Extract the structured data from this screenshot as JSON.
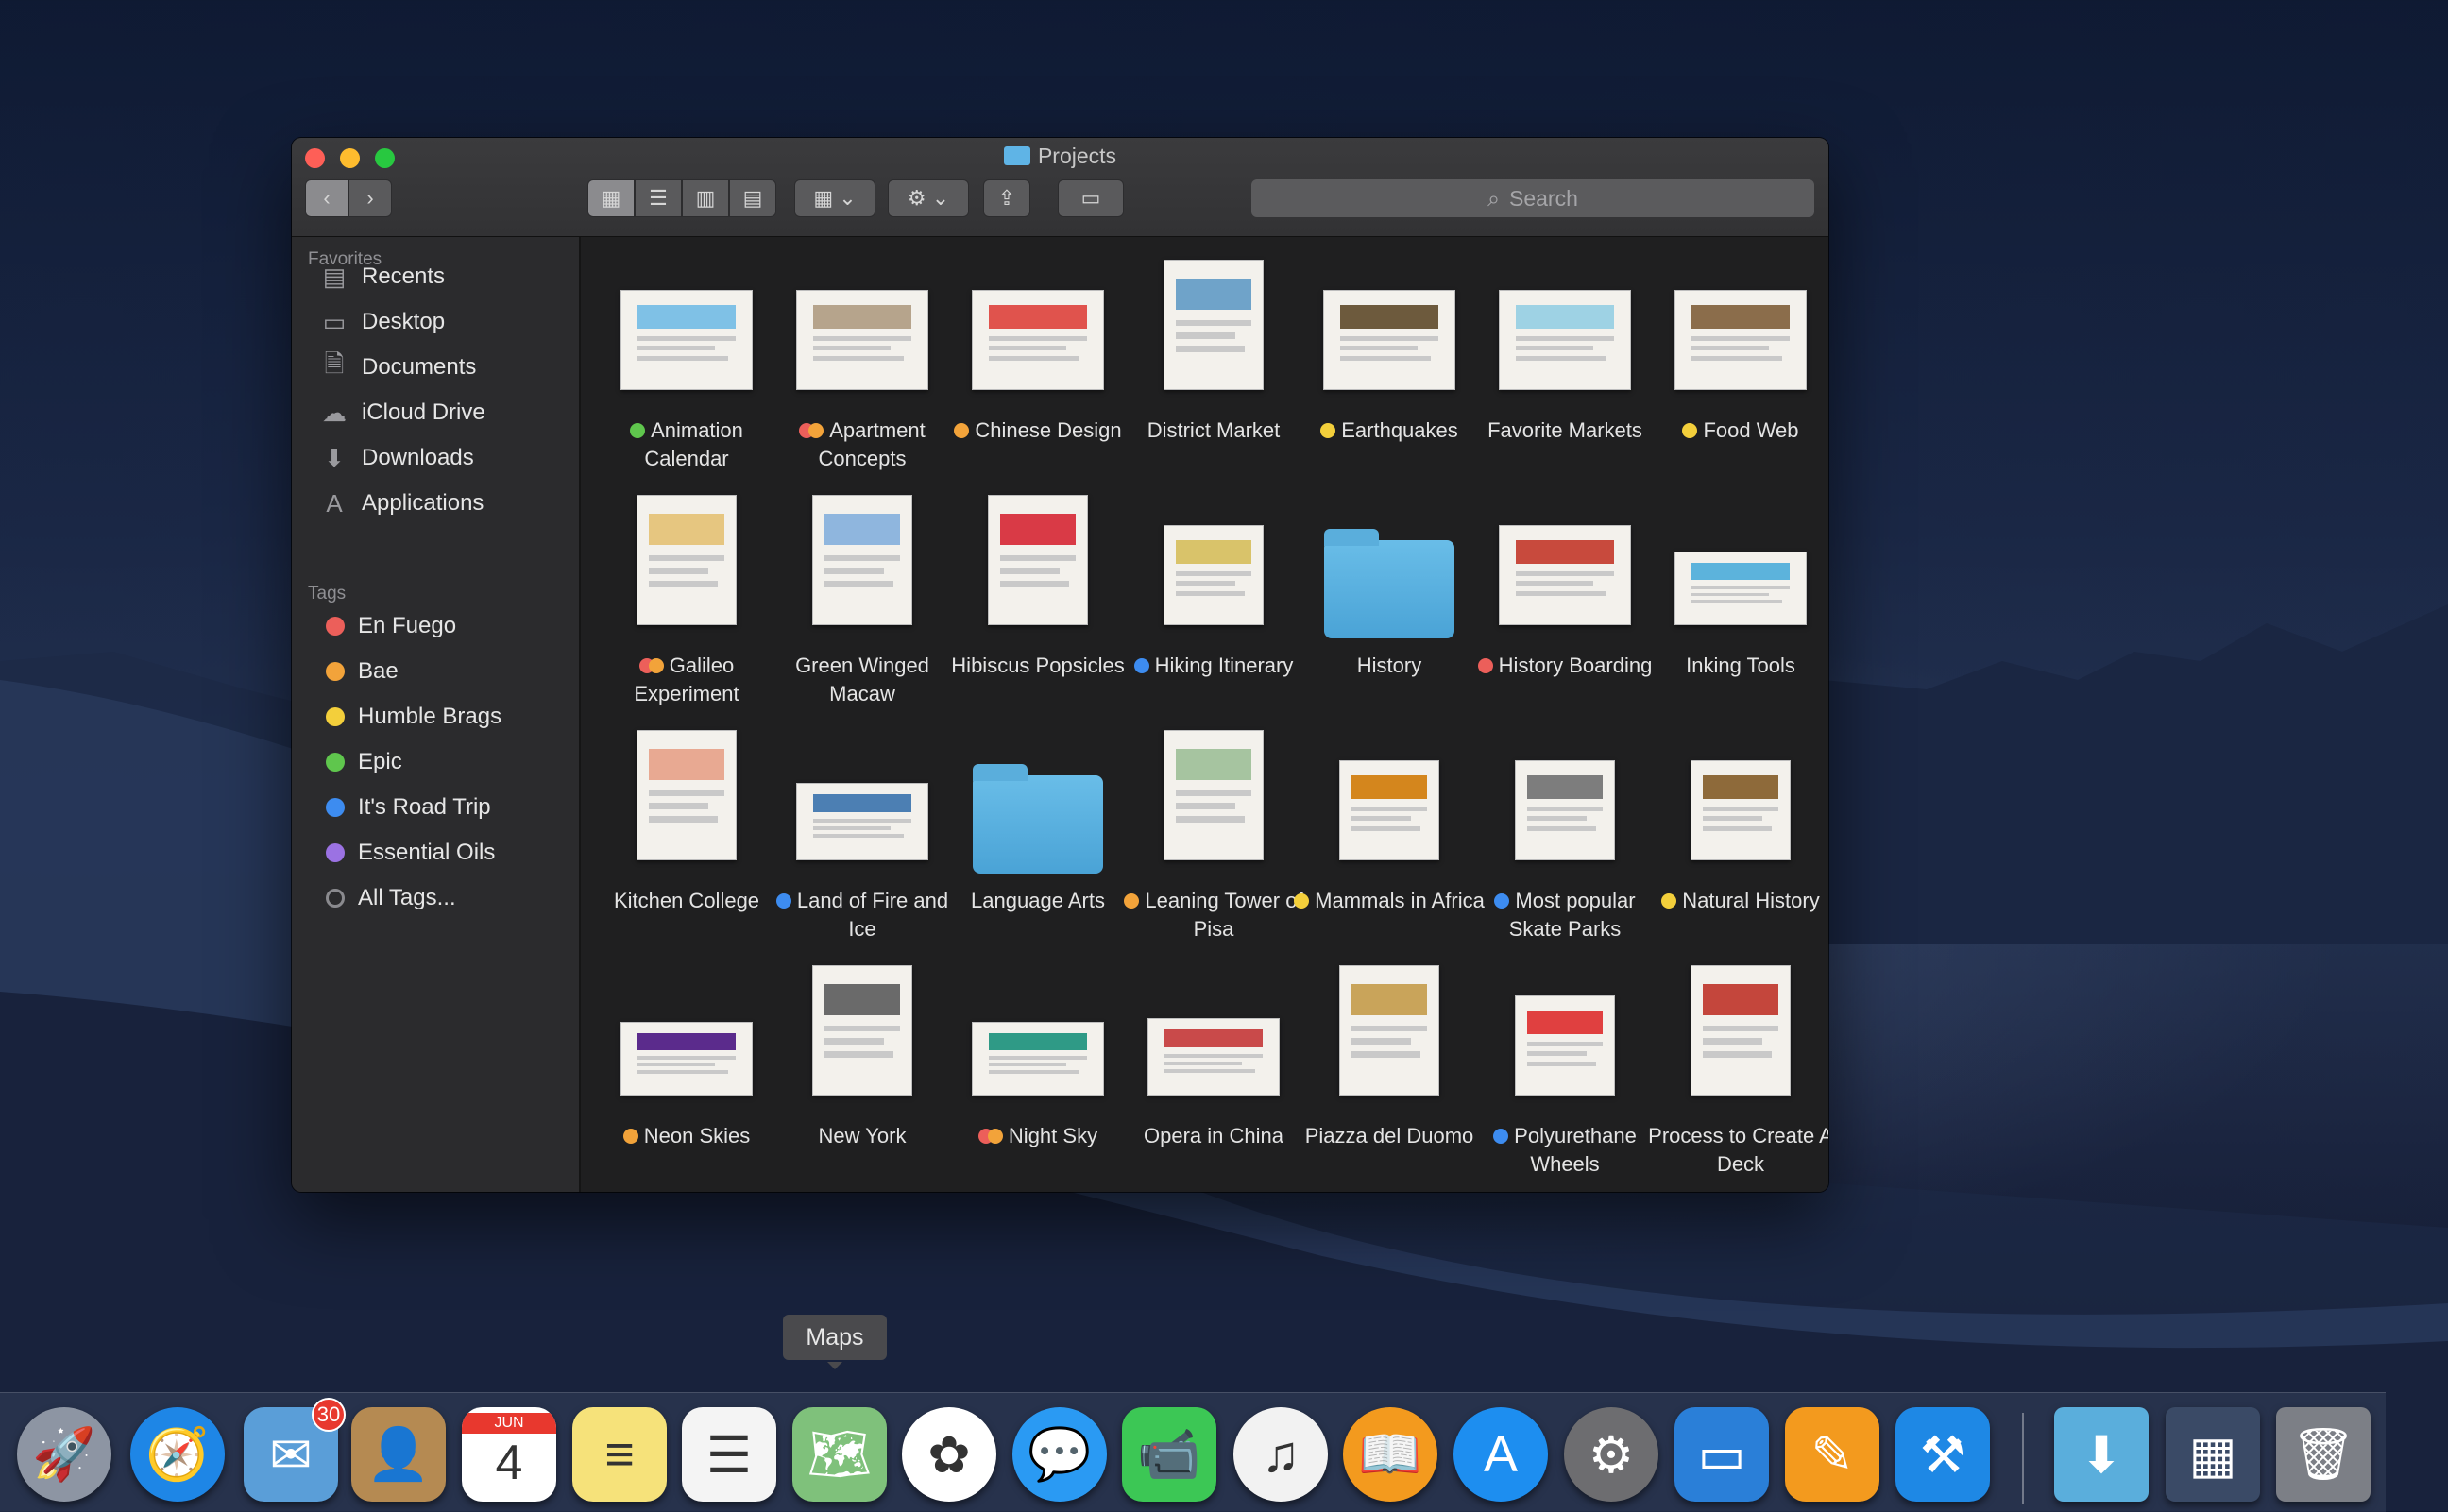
{
  "window": {
    "title": "Projects"
  },
  "toolbar": {
    "search_placeholder": "Search"
  },
  "sidebar": {
    "favorites_header": "Favorites",
    "favorites": [
      {
        "label": "Recents",
        "icon": "recents-icon"
      },
      {
        "label": "Desktop",
        "icon": "desktop-icon"
      },
      {
        "label": "Documents",
        "icon": "documents-icon"
      },
      {
        "label": "iCloud Drive",
        "icon": "icloud-icon"
      },
      {
        "label": "Downloads",
        "icon": "downloads-icon"
      },
      {
        "label": "Applications",
        "icon": "applications-icon"
      }
    ],
    "tags_header": "Tags",
    "tags": [
      {
        "label": "En Fuego",
        "color": "#ec5f5a"
      },
      {
        "label": "Bae",
        "color": "#f2a33a"
      },
      {
        "label": "Humble Brags",
        "color": "#f3cf3b"
      },
      {
        "label": "Epic",
        "color": "#5fc64d"
      },
      {
        "label": "It's Road Trip",
        "color": "#3d8cf0"
      },
      {
        "label": "Essential Oils",
        "color": "#9b72e3"
      },
      {
        "label": "All Tags...",
        "color": "#8a8a8e"
      }
    ]
  },
  "files": [
    {
      "name": "Animation Calendar",
      "tags": [
        "#5fc64d"
      ],
      "kind": "doc",
      "accent": "#7fc1e6"
    },
    {
      "name": "Apartment Concepts",
      "tags": [
        "#ec5f5a",
        "#f2a33a"
      ],
      "kind": "doc",
      "accent": "#b6a48c"
    },
    {
      "name": "Chinese Design",
      "tags": [
        "#f2a33a"
      ],
      "kind": "doc",
      "accent": "#e0534d"
    },
    {
      "name": "District Market",
      "tags": [],
      "kind": "doc",
      "accent": "#6fa3c9"
    },
    {
      "name": "Earthquakes",
      "tags": [
        "#f3cf3b"
      ],
      "kind": "doc",
      "accent": "#6d5a3d"
    },
    {
      "name": "Favorite Markets",
      "tags": [],
      "kind": "doc",
      "accent": "#9ed2e4"
    },
    {
      "name": "Food Web",
      "tags": [
        "#f3cf3b"
      ],
      "kind": "doc",
      "accent": "#8b6d4b"
    },
    {
      "name": "Galileo Experiment",
      "tags": [
        "#ec5f5a",
        "#f2a33a"
      ],
      "kind": "doc",
      "accent": "#e6c680"
    },
    {
      "name": "Green Winged Macaw",
      "tags": [],
      "kind": "doc",
      "accent": "#8fb6de"
    },
    {
      "name": "Hibiscus Popsicles",
      "tags": [],
      "kind": "doc",
      "accent": "#d93a46"
    },
    {
      "name": "Hiking Itinerary",
      "tags": [
        "#3d8cf0"
      ],
      "kind": "doc",
      "accent": "#d9c36a"
    },
    {
      "name": "History",
      "tags": [],
      "kind": "folder",
      "accent": "#5aaedc"
    },
    {
      "name": "History Boarding",
      "tags": [
        "#ec5f5a"
      ],
      "kind": "doc",
      "accent": "#c84a3d"
    },
    {
      "name": "Inking Tools",
      "tags": [],
      "kind": "doc",
      "accent": "#5cb3dc"
    },
    {
      "name": "Kitchen College",
      "tags": [],
      "kind": "doc",
      "accent": "#e8a992"
    },
    {
      "name": "Land of Fire and Ice",
      "tags": [
        "#3d8cf0"
      ],
      "kind": "doc",
      "accent": "#4c7fb3"
    },
    {
      "name": "Language Arts",
      "tags": [],
      "kind": "folder",
      "accent": "#5aaedc"
    },
    {
      "name": "Leaning Tower of Pisa",
      "tags": [
        "#f2a33a"
      ],
      "kind": "doc",
      "accent": "#a6c4a0"
    },
    {
      "name": "Mammals in Africa",
      "tags": [
        "#f3cf3b"
      ],
      "kind": "doc",
      "accent": "#d4861d"
    },
    {
      "name": "Most popular Skate Parks",
      "tags": [
        "#3d8cf0"
      ],
      "kind": "doc",
      "accent": "#7d7d7d"
    },
    {
      "name": "Natural History",
      "tags": [
        "#f3cf3b"
      ],
      "kind": "doc",
      "accent": "#8e6a3a"
    },
    {
      "name": "Neon Skies",
      "tags": [
        "#f2a33a"
      ],
      "kind": "doc",
      "accent": "#5b2b8c"
    },
    {
      "name": "New York",
      "tags": [],
      "kind": "doc",
      "accent": "#6a6a6a"
    },
    {
      "name": "Night Sky",
      "tags": [
        "#ec5f5a",
        "#f2a33a"
      ],
      "kind": "doc",
      "accent": "#2f9a86"
    },
    {
      "name": "Opera in China",
      "tags": [],
      "kind": "doc",
      "accent": "#c94a4a"
    },
    {
      "name": "Piazza del Duomo",
      "tags": [],
      "kind": "doc",
      "accent": "#c9a45a"
    },
    {
      "name": "Polyurethane Wheels",
      "tags": [
        "#3d8cf0"
      ],
      "kind": "doc",
      "accent": "#e04040"
    },
    {
      "name": "Process to Create A Deck",
      "tags": [],
      "kind": "doc",
      "accent": "#c4463c"
    }
  ],
  "dock": {
    "tooltip": "Maps",
    "apps": [
      {
        "name": "launchpad",
        "icon": "rocket-icon",
        "glyph": "🚀",
        "color": "#8d95a3"
      },
      {
        "name": "safari",
        "icon": "compass-icon",
        "glyph": "🧭",
        "color": "#1e86e6"
      },
      {
        "name": "mail",
        "icon": "stamp-icon",
        "glyph": "✉",
        "color": "#5a9ed8",
        "badge": "30"
      },
      {
        "name": "contacts",
        "icon": "contacts-icon",
        "glyph": "👤",
        "color": "#b58a52"
      },
      {
        "name": "calendar",
        "icon": "calendar-icon",
        "glyph": "4",
        "color": "#ffffff",
        "sub": "JUN"
      },
      {
        "name": "notes",
        "icon": "notes-icon",
        "glyph": "≡",
        "color": "#f6e27a"
      },
      {
        "name": "reminders",
        "icon": "reminders-icon",
        "glyph": "☰",
        "color": "#f4f4f4"
      },
      {
        "name": "maps",
        "icon": "map-icon",
        "glyph": "🗺",
        "color": "#7fc17b"
      },
      {
        "name": "photos",
        "icon": "photos-icon",
        "glyph": "✿",
        "color": "#ffffff"
      },
      {
        "name": "messages",
        "icon": "message-bubble-icon",
        "glyph": "💬",
        "color": "#2a9af3"
      },
      {
        "name": "facetime",
        "icon": "video-camera-icon",
        "glyph": "📹",
        "color": "#3cc755"
      },
      {
        "name": "itunes",
        "icon": "music-note-icon",
        "glyph": "♫",
        "color": "#f2f2f2"
      },
      {
        "name": "ibooks",
        "icon": "book-icon",
        "glyph": "📖",
        "color": "#f39a1e"
      },
      {
        "name": "app-store",
        "icon": "app-store-icon",
        "glyph": "A",
        "color": "#1d8ef0"
      },
      {
        "name": "system-preferences",
        "icon": "gear-icon",
        "glyph": "⚙",
        "color": "#6d6d70"
      },
      {
        "name": "keynote",
        "icon": "podium-icon",
        "glyph": "▭",
        "color": "#2a7fd8"
      },
      {
        "name": "pages",
        "icon": "pen-document-icon",
        "glyph": "✎",
        "color": "#f39a1e"
      },
      {
        "name": "xcode",
        "icon": "hammer-icon",
        "glyph": "⚒",
        "color": "#1e88e5"
      },
      {
        "name": "downloads-stack",
        "icon": "downloads-folder-icon",
        "glyph": "⬇",
        "color": "#5aaedc"
      },
      {
        "name": "recent-stack",
        "icon": "image-stack-icon",
        "glyph": "▦",
        "color": "#3a4a66"
      },
      {
        "name": "trash",
        "icon": "trash-icon",
        "glyph": "🗑",
        "color": "#7c7f86"
      }
    ]
  }
}
